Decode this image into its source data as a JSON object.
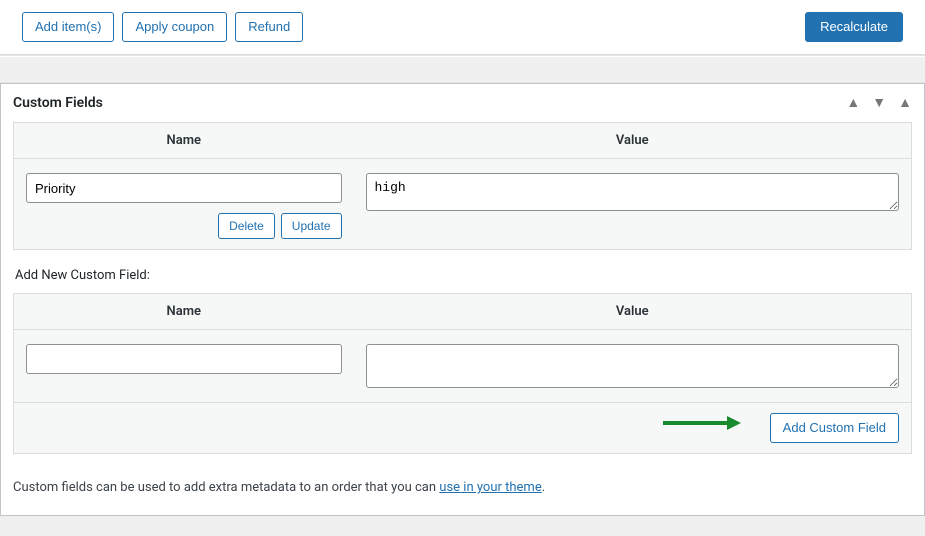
{
  "topbar": {
    "addItems": "Add item(s)",
    "applyCoupon": "Apply coupon",
    "refund": "Refund",
    "recalculate": "Recalculate"
  },
  "customFields": {
    "title": "Custom Fields",
    "colName": "Name",
    "colValue": "Value",
    "row": {
      "name": "Priority",
      "value": "high",
      "deleteLabel": "Delete",
      "updateLabel": "Update"
    },
    "addNewHeading": "Add New Custom Field:",
    "newRow": {
      "name": "",
      "value": ""
    },
    "addButton": "Add Custom Field",
    "helpPrefix": "Custom fields can be used to add extra metadata to an order that you can ",
    "helpLink": "use in your theme",
    "helpSuffix": "."
  }
}
